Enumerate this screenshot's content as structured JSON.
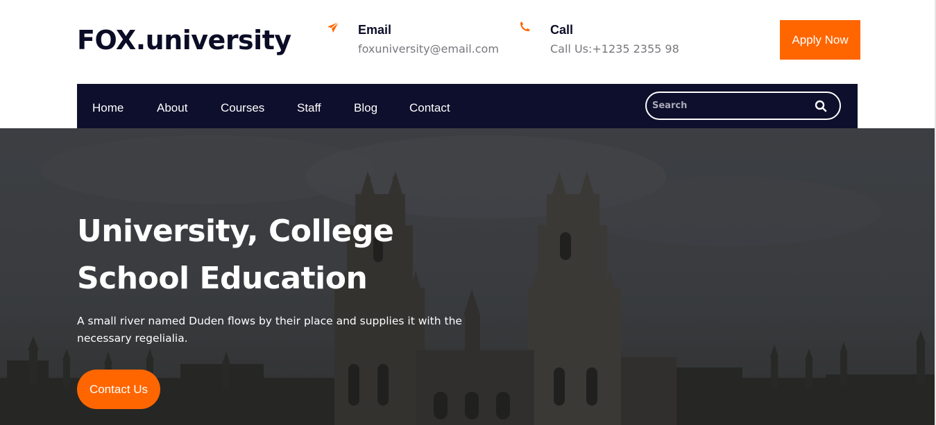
{
  "header": {
    "logo": "FOX.university",
    "email": {
      "icon": "paper-plane-icon",
      "title": "Email",
      "text": "foxuniversity@email.com"
    },
    "call": {
      "icon": "phone-icon",
      "title": "Call",
      "text": "Call Us:+1235 2355 98"
    },
    "apply_label": "Apply Now"
  },
  "nav": {
    "items": [
      {
        "label": "Home"
      },
      {
        "label": "About"
      },
      {
        "label": "Courses"
      },
      {
        "label": "Staff"
      },
      {
        "label": "Blog"
      },
      {
        "label": "Contact"
      }
    ],
    "search": {
      "placeholder": "Search",
      "icon": "search-icon"
    }
  },
  "hero": {
    "title_line1": "University, College",
    "title_line2": "School Education",
    "subtitle": "A small river named Duden flows by their place and supplies it with the necessary regelialia.",
    "cta_label": "Contact Us",
    "background": "university-building-photo"
  },
  "colors": {
    "accent": "#ff6600",
    "navy": "#0e0f2c",
    "text_dark": "#0b0c26",
    "text_muted": "#77787e"
  }
}
